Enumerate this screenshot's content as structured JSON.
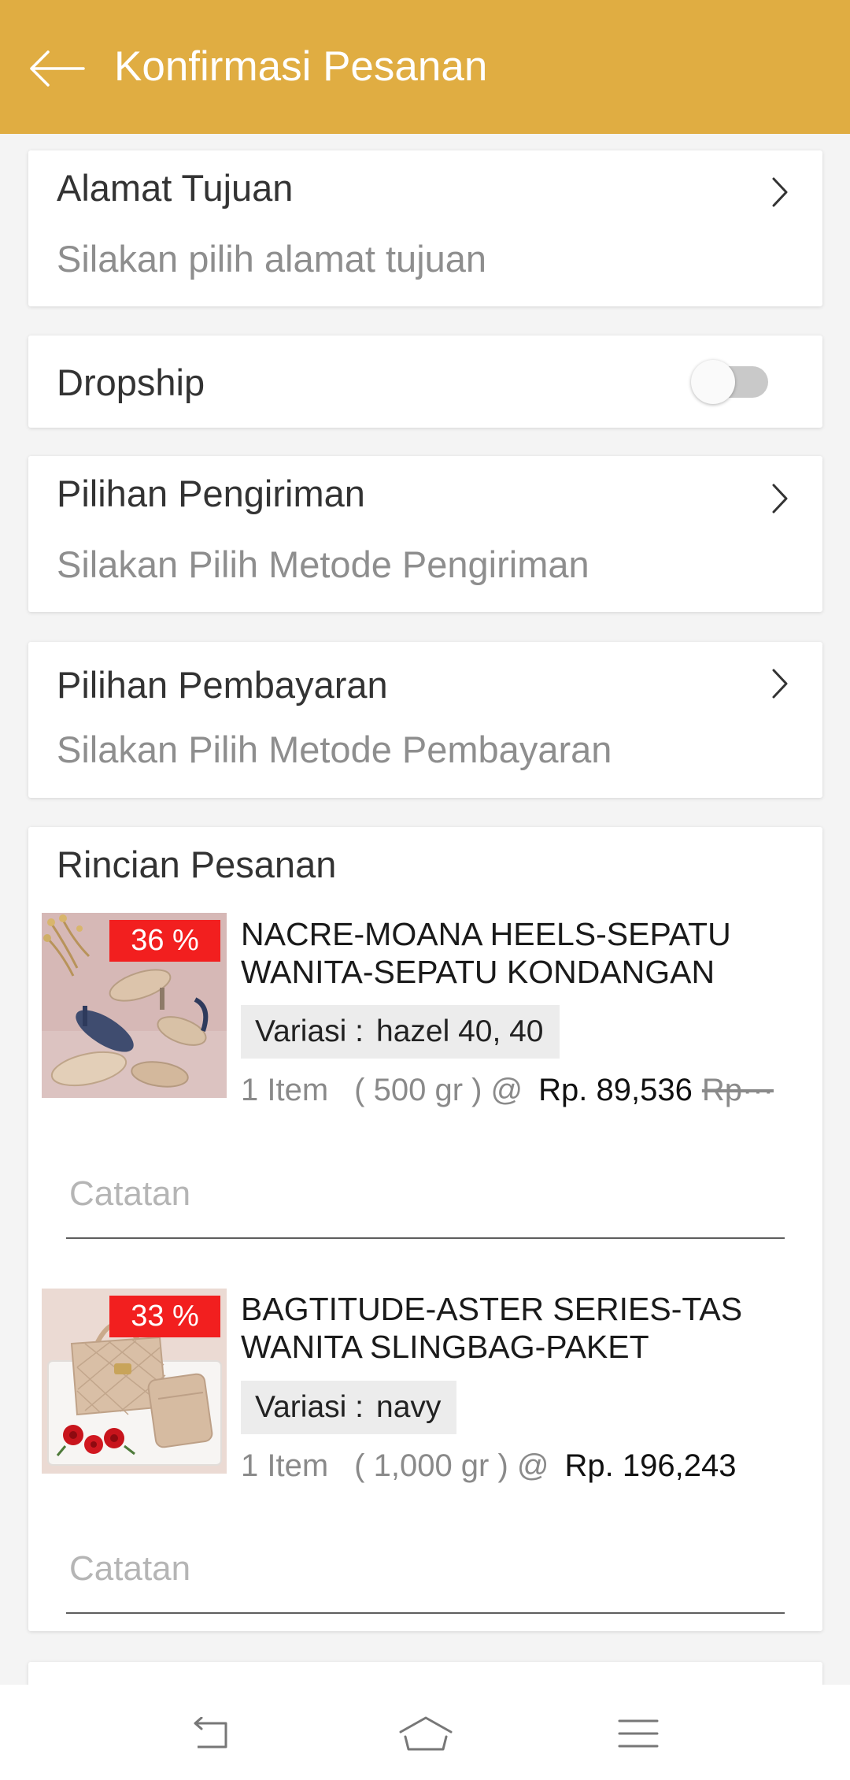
{
  "header": {
    "title": "Konfirmasi Pesanan",
    "back_icon": "arrow-left-icon"
  },
  "address": {
    "title": "Alamat Tujuan",
    "hint": "Silakan pilih alamat tujuan",
    "icon": "chevron-right-icon"
  },
  "dropship": {
    "label": "Dropship",
    "enabled": false
  },
  "shipping": {
    "title": "Pilihan Pengiriman",
    "hint": "Silakan Pilih Metode Pengiriman",
    "icon": "chevron-right-icon"
  },
  "payment": {
    "title": "Pilihan Pembayaran",
    "hint": "Silakan Pilih Metode Pembayaran",
    "icon": "chevron-right-icon"
  },
  "order": {
    "title": "Rincian Pesanan",
    "items": [
      {
        "discount": "36 %",
        "name": "NACRE-MOANA HEELS-SEPATU WANITA-SEPATU KONDANGAN",
        "variation_label": "Variasi :",
        "variation": "hazel 40, 40",
        "quantity": "1 Item",
        "weight": "( 500 gr ) @",
        "price": "Rp. 89,536",
        "original_price": "Rp···",
        "note_placeholder": "Catatan"
      },
      {
        "discount": "33 %",
        "name": "BAGTITUDE-ASTER SERIES-TAS WANITA SLINGBAG-PAKET",
        "variation_label": "Variasi :",
        "variation": "navy",
        "quantity": "1 Item",
        "weight": "( 1,000 gr ) @",
        "price": "Rp. 196,243",
        "note_placeholder": "Catatan"
      }
    ]
  },
  "nav_bar": {
    "icons": [
      "back-icon",
      "home-icon",
      "menu-icon"
    ]
  },
  "colors": {
    "header": "#E0AD42",
    "discount_badge": "#F21F1F",
    "page_background": "#F4F4F4",
    "hint_text": "#8E8E8E",
    "placeholder_text": "#B5B5B5"
  }
}
